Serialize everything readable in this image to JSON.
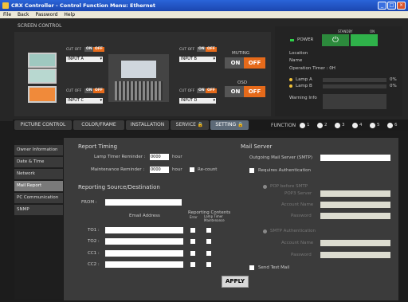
{
  "window": {
    "title": "CRX Controller - Control Function Menu: Ethernet"
  },
  "menu": [
    "File",
    "Back",
    "Password",
    "Help"
  ],
  "screen_control": {
    "label": "SCREEN CONTROL",
    "cut_off": "CUT OFF",
    "on": "ON",
    "off": "OFF",
    "inputs": [
      "INPUT A",
      "INPUT B",
      "INPUT C",
      "INPUT D"
    ],
    "muting": "MUTING",
    "osd": "OSD"
  },
  "status": {
    "standby": "STANDBY",
    "on_label": "ON",
    "power": "POWER",
    "location": "Location",
    "name": "Name",
    "op_timer": "Operation Timer : 0H",
    "lamp_a": "Lamp A",
    "lamp_b": "Lamp B",
    "lamp_a_pct": "0%",
    "lamp_b_pct": "0%",
    "lamp_a_value": 0,
    "lamp_b_value": 0,
    "warning": "Warning Info"
  },
  "tabs": [
    "PICTURE CONTROL",
    "COLOR/FRAME",
    "INSTALLATION",
    "SERVICE",
    "SETTING"
  ],
  "function_label": "FUNCTION",
  "function_nums": [
    "1",
    "2",
    "3",
    "4",
    "5",
    "6"
  ],
  "sidebar": [
    "Owner Information",
    "Date & Time",
    "Network",
    "Mail Report",
    "PC Communication",
    "SNMP"
  ],
  "report": {
    "timing": "Report Timing",
    "lamp_timer": "Lamp Timer Reminder :",
    "lamp_val": "0000",
    "hour": "hour",
    "maint": "Maintenance Reminder :",
    "maint_val": "0000",
    "hour2": "hour",
    "recount": "Re-count",
    "source": "Reporting Source/Destination",
    "from": "FROM :",
    "email": "Email Address",
    "contents": "Reporting Contents",
    "error": "Error",
    "lamp_maint": "Lamp Timer Maintenance",
    "to": [
      "TO1 :",
      "TO2 :",
      "CC1 :",
      "CC2 :"
    ]
  },
  "mail": {
    "server": "Mail Server",
    "smtp": "Outgoing Mail Server (SMTP)",
    "req_auth": "Requires Authentication",
    "pop": "POP before SMTP",
    "pop3": "POP3 Server",
    "account": "Account Name",
    "password": "Password",
    "smtp_auth": "SMTP Authentication",
    "account2": "Account Name",
    "password2": "Password",
    "send_test": "Send Test Mail"
  },
  "apply": "APPLY"
}
